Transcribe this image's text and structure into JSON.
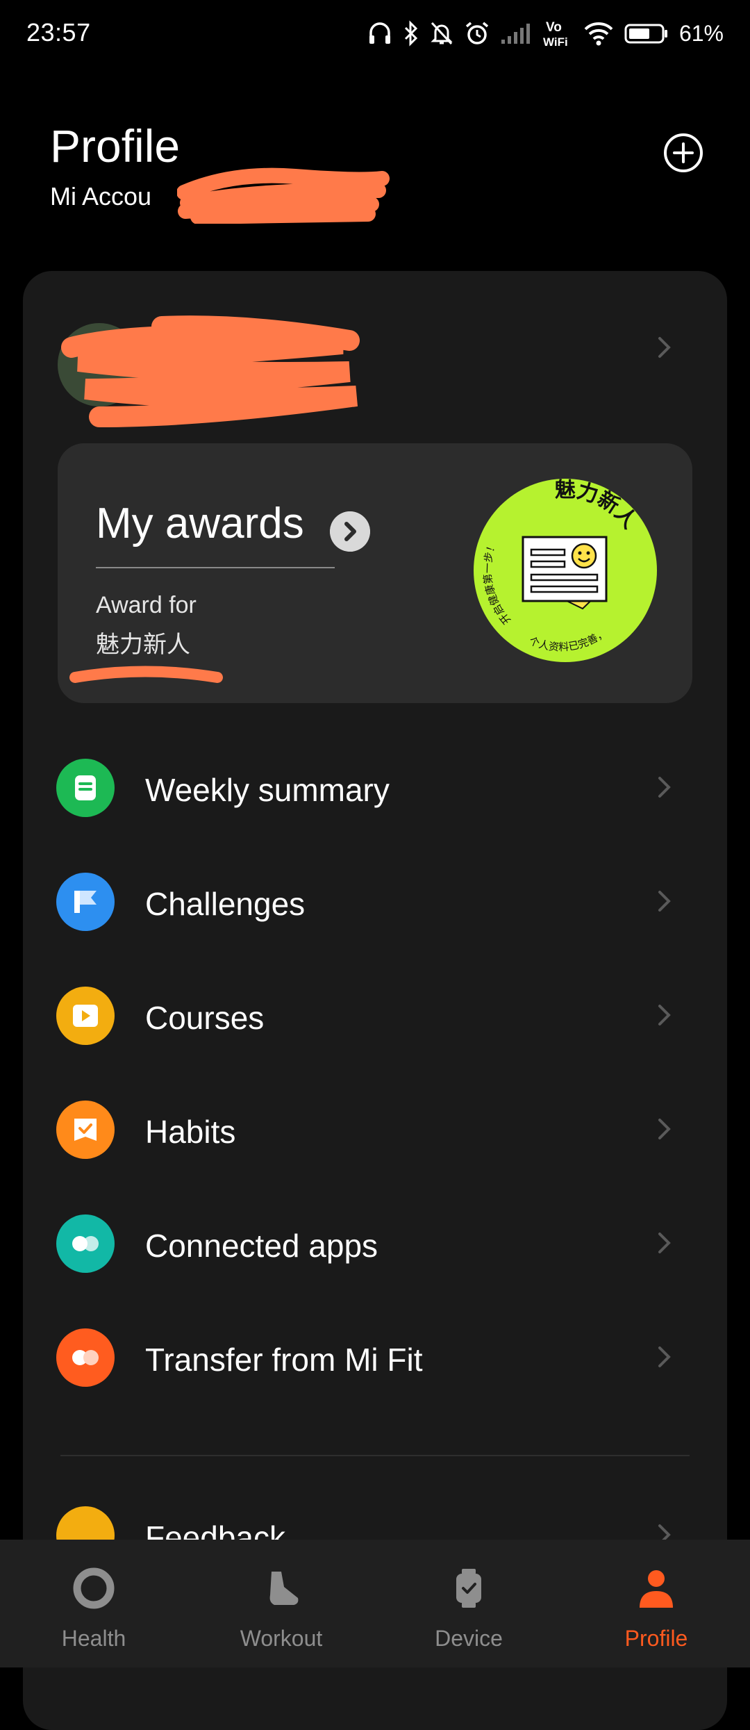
{
  "status_bar": {
    "time": "23:57",
    "icons": [
      "headset-icon",
      "bluetooth-icon",
      "silent-icon",
      "alarm-icon",
      "signal-icon",
      "vowifi-icon",
      "wifi-icon",
      "battery-icon"
    ],
    "vowifi_top": "Vo",
    "vowifi_bottom": "WiFi",
    "battery": "61%"
  },
  "header": {
    "title": "Profile",
    "account_label": "Mi Accou",
    "add_icon": "plus-circle-icon"
  },
  "awards": {
    "title": "My awards",
    "award_for": "Award for",
    "award_name": "魅力新人",
    "badge_top_text": "魅力新人",
    "badge_left_text": "开启健康第一步！",
    "badge_bottom_text": "个人资料已完善，"
  },
  "menu": [
    {
      "label": "Weekly summary",
      "icon": "summary-icon",
      "color": "#1db954"
    },
    {
      "label": "Challenges",
      "icon": "flag-icon",
      "color": "#2d8ff0"
    },
    {
      "label": "Courses",
      "icon": "play-icon",
      "color": "#f3ad10"
    },
    {
      "label": "Habits",
      "icon": "checkbox-icon",
      "color": "#ff8a1a"
    },
    {
      "label": "Connected apps",
      "icon": "link-icon",
      "color": "#12b8a6"
    },
    {
      "label": "Transfer from Mi Fit",
      "icon": "transfer-icon",
      "color": "#ff5c1f"
    },
    {
      "label": "Feedback",
      "icon": "feedback-icon",
      "color": "#f3ad10"
    }
  ],
  "nav": [
    {
      "label": "Health",
      "icon": "health-icon"
    },
    {
      "label": "Workout",
      "icon": "shoe-icon"
    },
    {
      "label": "Device",
      "icon": "watch-icon"
    },
    {
      "label": "Profile",
      "icon": "person-icon",
      "active": true
    }
  ],
  "colors": {
    "accent": "#ff5a1f",
    "card": "#1a1a1a",
    "awards_card": "#2c2c2c",
    "badge": "#b6f22f"
  }
}
